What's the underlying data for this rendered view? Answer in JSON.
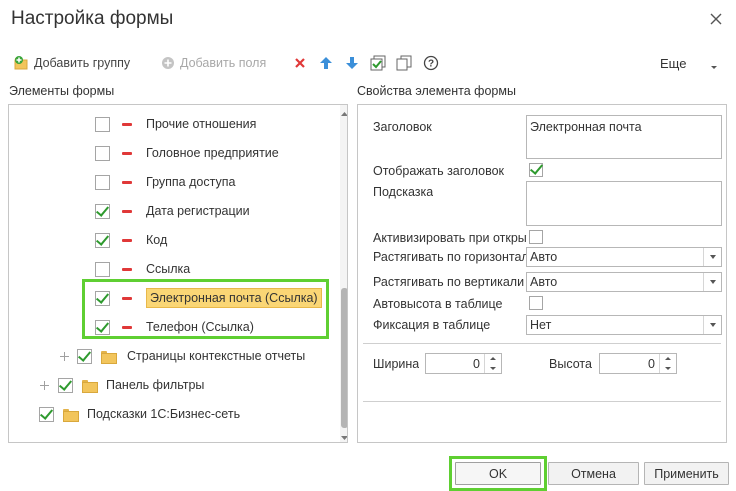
{
  "window": {
    "title": "Настройка формы"
  },
  "toolbar": {
    "add_group_label": "Добавить группу",
    "add_field_label": "Добавить поля",
    "more_label": "Еще",
    "icons": [
      "delete-icon",
      "move-up-icon",
      "move-down-icon",
      "check-all-icon",
      "copy-icon",
      "help-icon"
    ]
  },
  "left_panel": {
    "label": "Элементы формы",
    "items": [
      {
        "label": "Прочие отношения",
        "checked": false
      },
      {
        "label": "Головное предприятие",
        "checked": false
      },
      {
        "label": "Группа доступа",
        "checked": false
      },
      {
        "label": "Дата регистрации",
        "checked": true
      },
      {
        "label": "Код",
        "checked": true
      },
      {
        "label": "Ссылка",
        "checked": false
      },
      {
        "label": "Электронная почта (Ссылка)",
        "checked": true,
        "selected": true
      },
      {
        "label": "Телефон (Ссылка)",
        "checked": true
      }
    ],
    "groups": [
      {
        "label": "Страницы контекстные отчеты",
        "checked": true
      },
      {
        "label": "Панель фильтры",
        "checked": true
      },
      {
        "label": "Подсказки 1С:Бизнес-сеть",
        "checked": true
      }
    ]
  },
  "right_panel": {
    "label": "Свойства элемента формы",
    "caption_label": "Заголовок",
    "caption_value": "Электронная почта",
    "show_caption_label": "Отображать заголовок",
    "show_caption_checked": true,
    "hint_label": "Подсказка",
    "hint_value": "",
    "activate_label": "Активизировать при открытии",
    "activate_checked": false,
    "stretch_h_label": "Растягивать по горизонтали",
    "stretch_h_value": "Авто",
    "stretch_v_label": "Растягивать по вертикали",
    "stretch_v_value": "Авто",
    "autoheight_label": "Автовысота в таблице",
    "autoheight_checked": false,
    "fix_label": "Фиксация в таблице",
    "fix_value": "Нет",
    "width_label": "Ширина",
    "width_value": "0",
    "height_label": "Высота",
    "height_value": "0"
  },
  "buttons": {
    "ok": "OK",
    "cancel": "Отмена",
    "apply": "Применить"
  },
  "colors": {
    "highlight": "#5fcf32",
    "selection": "#fad675",
    "check": "#2e9a2e",
    "delete": "#e03838"
  }
}
